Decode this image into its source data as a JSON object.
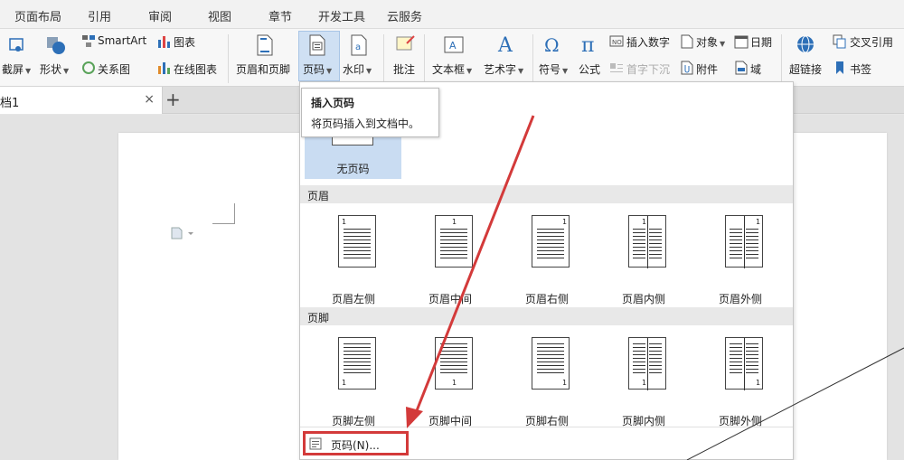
{
  "menu": {
    "tabs": [
      "页面布局",
      "引用",
      "审阅",
      "视图",
      "章节",
      "开发工具",
      "云服务"
    ]
  },
  "ribbon": {
    "screenshot": "截屏",
    "shape": "形状",
    "smartart": "SmartArt",
    "relation": "关系图",
    "chart": "图表",
    "online_chart": "在线图表",
    "header_footer": "页眉和页脚",
    "page_number": "页码",
    "watermark": "水印",
    "comment": "批注",
    "textbox": "文本框",
    "wordart": "艺术字",
    "symbol": "符号",
    "formula": "公式",
    "insert_number": "插入数字",
    "drop_cap": "首字下沉",
    "object": "对象",
    "attachment": "附件",
    "date": "日期",
    "field": "域",
    "hyperlink": "超链接",
    "cross_ref": "交叉引用",
    "bookmark": "书签",
    "accent_color": "#2d6fb7"
  },
  "doc_tabs": {
    "current": "档1",
    "close": "×",
    "add": "+"
  },
  "tooltip": {
    "title": "插入页码",
    "desc": "将页码插入到文档中。"
  },
  "dropdown": {
    "none_label": "无页码",
    "header_section": "页眉",
    "header_items": [
      "页眉左侧",
      "页眉中间",
      "页眉右侧",
      "页眉内侧",
      "页眉外侧"
    ],
    "footer_section": "页脚",
    "footer_items": [
      "页脚左侧",
      "页脚中间",
      "页脚右侧",
      "页脚内侧",
      "页脚外侧"
    ],
    "page_number_item": "页码(N)...",
    "page_digit": "1"
  },
  "annotation": {
    "arrow_color": "#d33a3a"
  }
}
